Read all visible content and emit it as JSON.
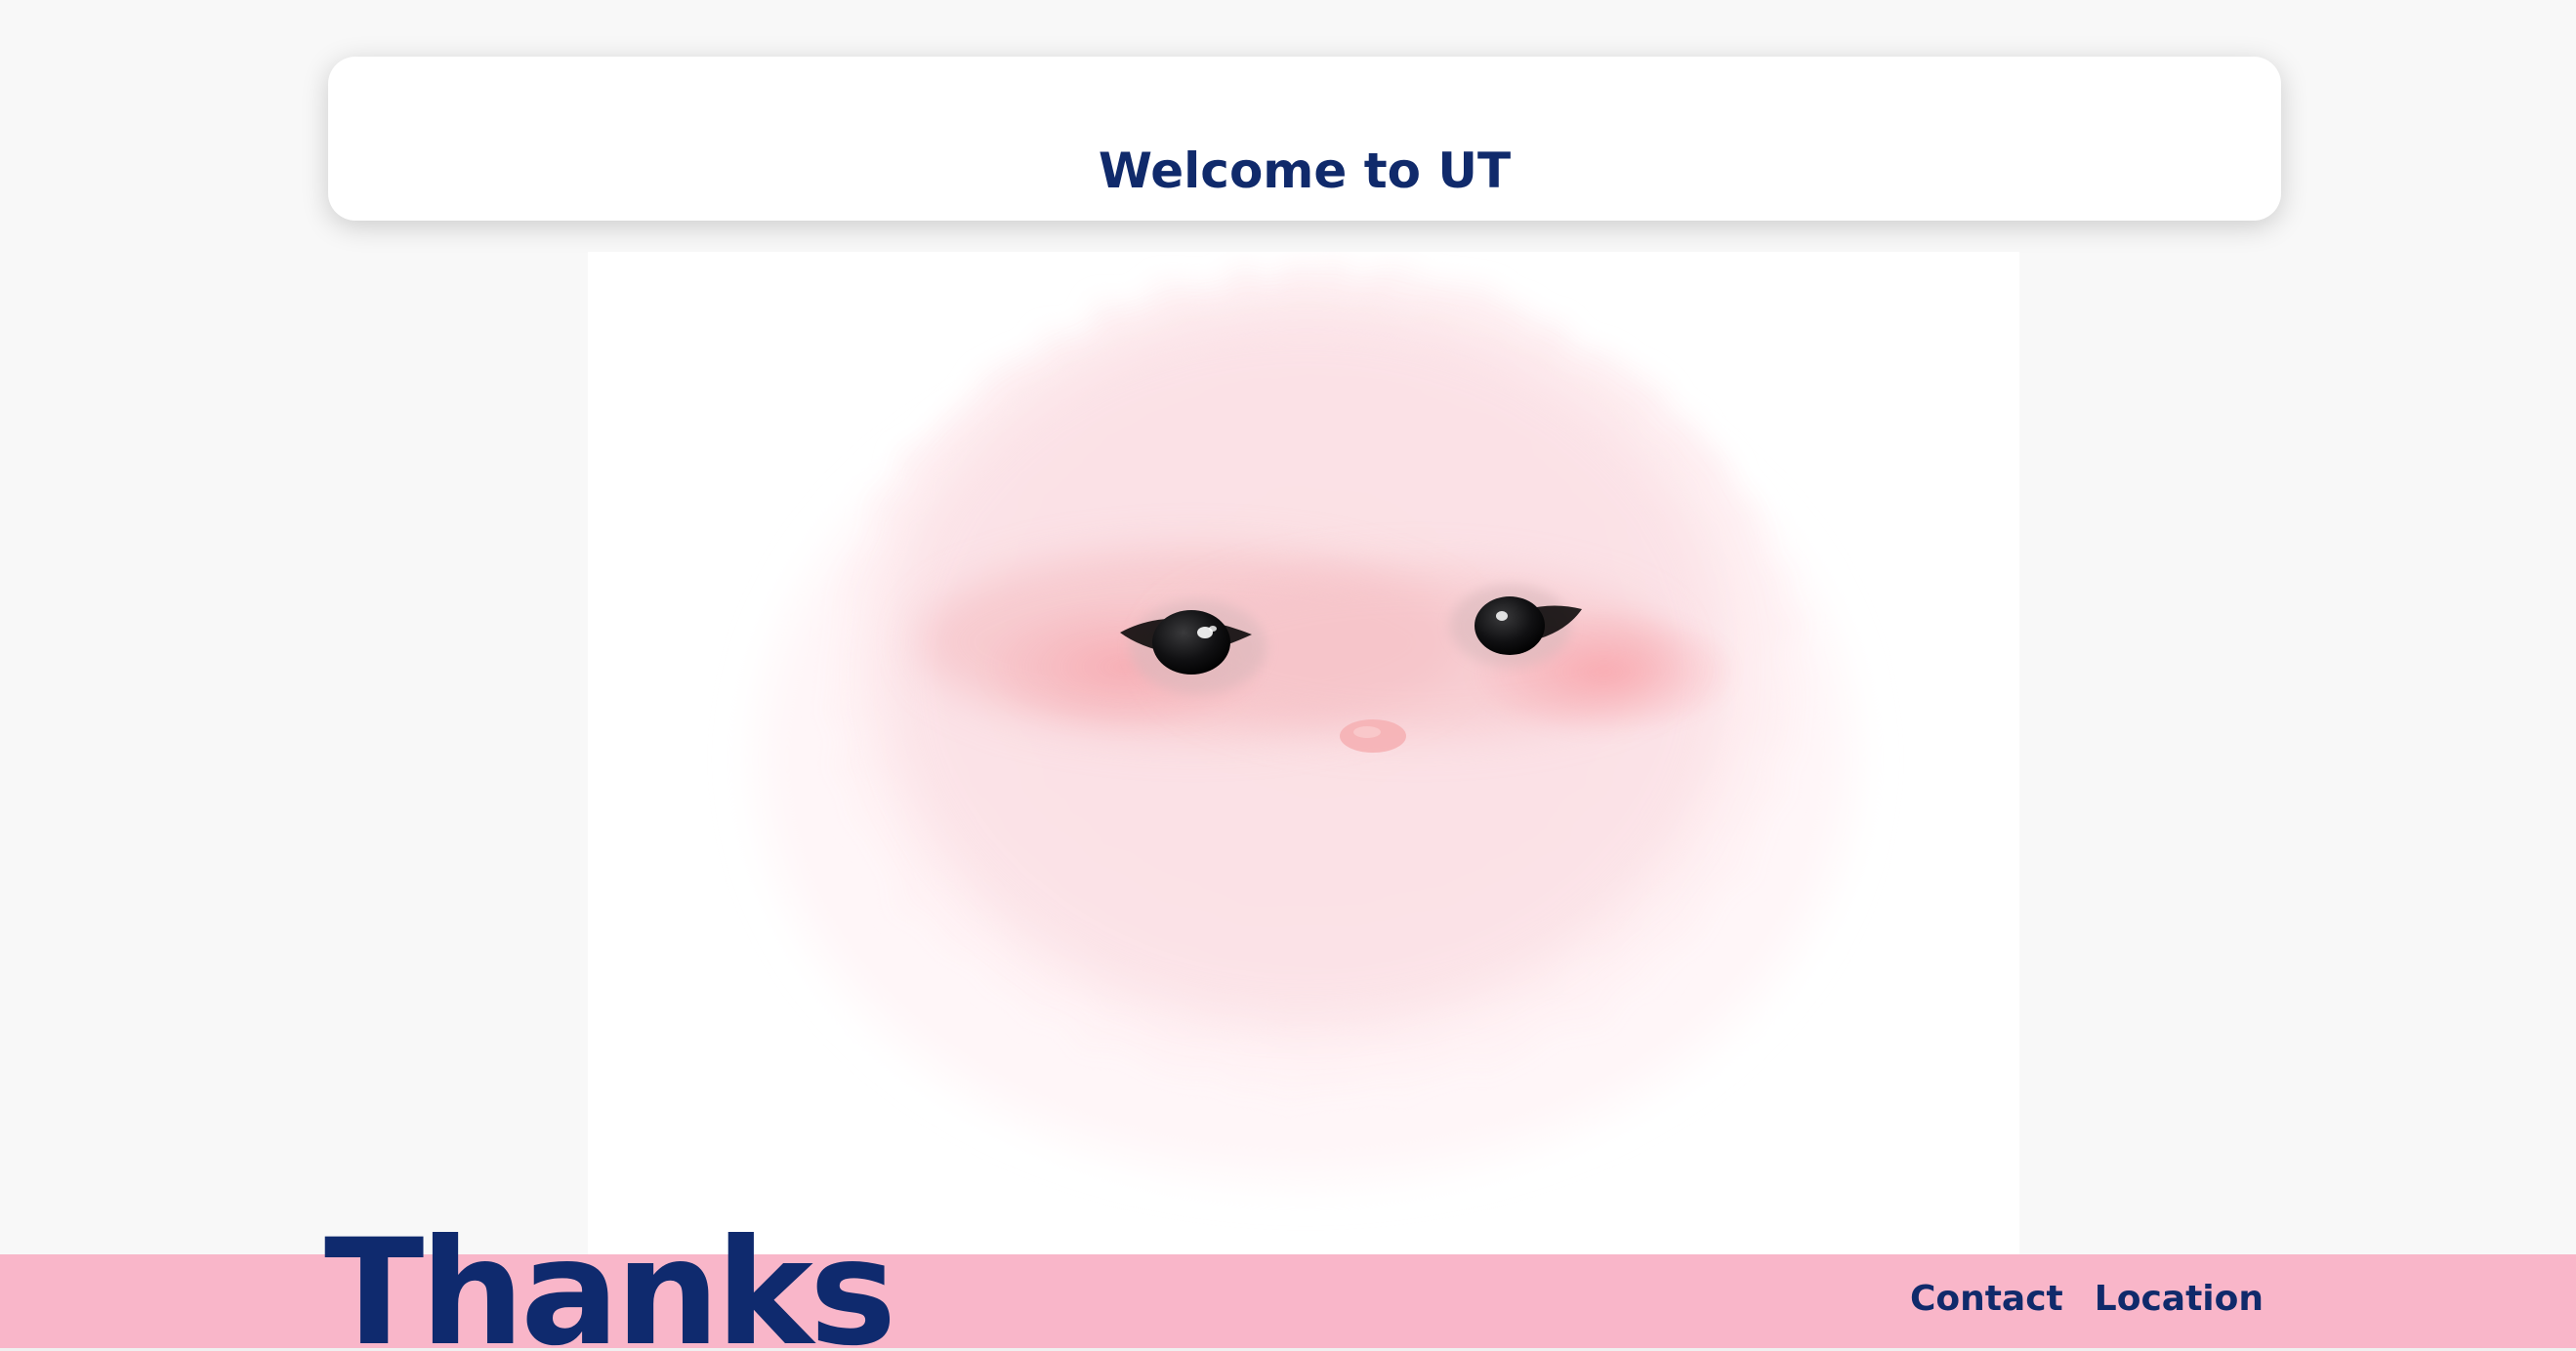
{
  "header": {
    "title": "Welcome to UT"
  },
  "hero": {
    "image_name": "fluffy-pink-creature-illustration"
  },
  "footer": {
    "headline": "Thanks",
    "links": [
      {
        "label": "Contact"
      },
      {
        "label": "Location"
      }
    ]
  },
  "colors": {
    "navy": "#102a6b",
    "pink": "#f9b6c9",
    "background": "#f8f8f8",
    "card": "#ffffff"
  }
}
